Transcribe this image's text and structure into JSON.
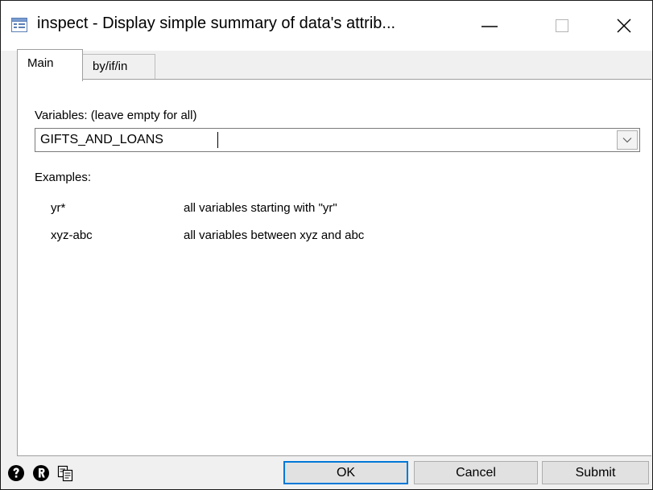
{
  "window": {
    "title": "inspect - Display simple summary of data's attrib..."
  },
  "tabs": [
    {
      "label": "Main",
      "active": true
    },
    {
      "label": "by/if/in",
      "active": false
    }
  ],
  "main": {
    "variables_label": "Variables: (leave empty for all)",
    "variables_value": "GIFTS_AND_LOANS",
    "examples_label": "Examples:",
    "examples": [
      {
        "pattern": "yr*",
        "description": "all variables starting with \"yr\""
      },
      {
        "pattern": "xyz-abc",
        "description": "all variables between xyz and abc"
      }
    ]
  },
  "buttons": {
    "ok": "OK",
    "cancel": "Cancel",
    "submit": "Submit"
  },
  "icons": {
    "app": "dialog-icon",
    "help": "help-icon",
    "reset": "reset-icon",
    "copy": "copy-command-icon"
  },
  "colors": {
    "focus_border": "#0078d7",
    "dialog_bg": "#f0f0f0",
    "panel_bg": "#ffffff"
  }
}
